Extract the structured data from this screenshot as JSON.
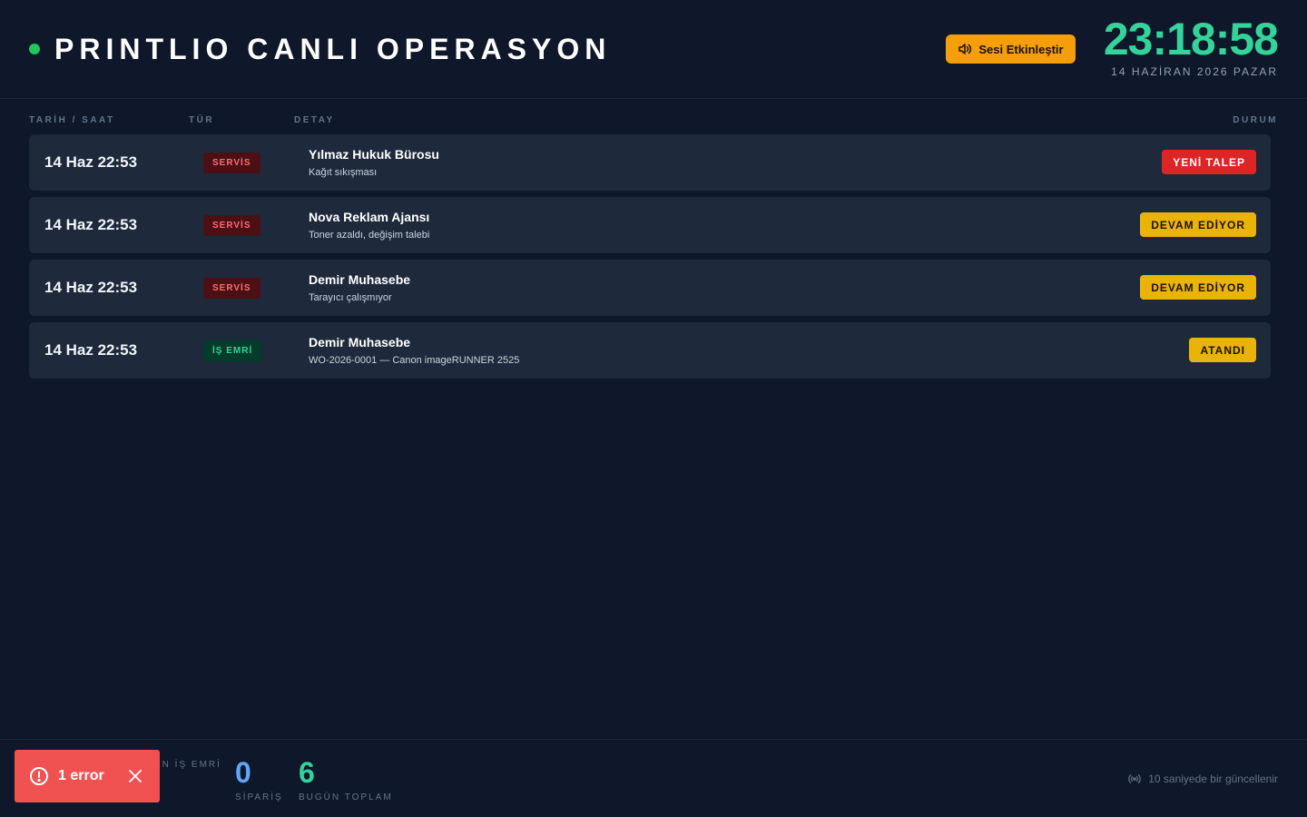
{
  "header": {
    "title": "PRINTLIO CANLI OPERASYON",
    "sound_button": "Sesi Etkinleştir",
    "clock": "23:18:58",
    "date": "14 HAZİRAN 2026 PAZAR"
  },
  "columns": {
    "time": "TARİH / SAAT",
    "type": "TÜR",
    "detail": "DETAY",
    "status": "DURUM"
  },
  "rows": [
    {
      "time": "14 Haz 22:53",
      "type": "SERVİS",
      "type_kind": "servis",
      "name": "Yılmaz Hukuk Bürosu",
      "desc": "Kağıt sıkışması",
      "status": "YENİ TALEP",
      "status_color": "red"
    },
    {
      "time": "14 Haz 22:53",
      "type": "SERVİS",
      "type_kind": "servis",
      "name": "Nova Reklam Ajansı",
      "desc": "Toner azaldı, değişim talebi",
      "status": "DEVAM EDİYOR",
      "status_color": "yellow"
    },
    {
      "time": "14 Haz 22:53",
      "type": "SERVİS",
      "type_kind": "servis",
      "name": "Demir Muhasebe",
      "desc": "Tarayıcı çalışmıyor",
      "status": "DEVAM EDİYOR",
      "status_color": "yellow"
    },
    {
      "time": "14 Haz 22:53",
      "type": "İŞ EMRİ",
      "type_kind": "isemri",
      "name": "Demir Muhasebe",
      "desc": "WO-2026-0001 — Canon imageRUNNER 2525",
      "status": "ATANDI",
      "status_color": "yellow"
    }
  ],
  "footer": {
    "stats": [
      {
        "value": "",
        "label": "EN İŞ EMRİ",
        "color": "#60a5fa"
      },
      {
        "value": "0",
        "label": "SİPARİŞ",
        "color": "#60a5fa"
      },
      {
        "value": "6",
        "label": "BUGÜN TOPLAM",
        "color": "#34d399"
      }
    ],
    "update_text": "10 saniyede bir güncellenir"
  },
  "error_toast": {
    "text": "1 error"
  },
  "colors": {
    "accent_green": "#34d399",
    "live_dot": "#22c55e",
    "sound_button": "#f59e0b",
    "status_red": "#dc2626",
    "status_yellow": "#eab308",
    "error_toast": "#f05252"
  }
}
